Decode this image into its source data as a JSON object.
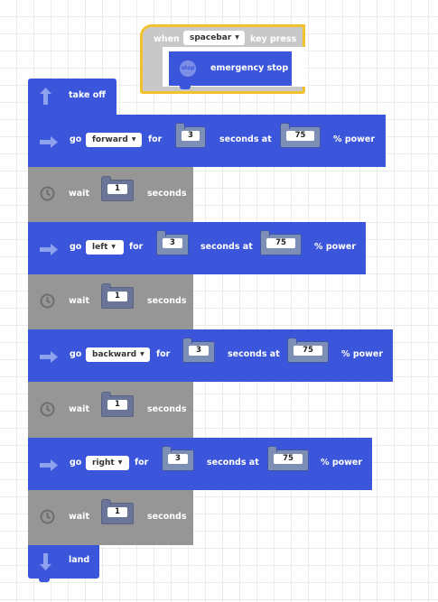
{
  "event": {
    "when_label": "when",
    "key_value": "spacebar",
    "key_press_label": "key press",
    "stop_icon_label": "stop",
    "action_label": "emergency stop"
  },
  "blocks": {
    "takeoff": {
      "label": "take off"
    },
    "go1": {
      "go": "go",
      "direction": "forward",
      "for": "for",
      "duration": "3",
      "seconds_at": "seconds at",
      "power": "75",
      "power_label": "% power"
    },
    "wait1": {
      "wait": "wait",
      "duration": "1",
      "seconds": "seconds"
    },
    "go2": {
      "go": "go",
      "direction": "left",
      "for": "for",
      "duration": "3",
      "seconds_at": "seconds at",
      "power": "75",
      "power_label": "% power"
    },
    "wait2": {
      "wait": "wait",
      "duration": "1",
      "seconds": "seconds"
    },
    "go3": {
      "go": "go",
      "direction": "backward",
      "for": "for",
      "duration": "3",
      "seconds_at": "seconds at",
      "power": "75",
      "power_label": "% power"
    },
    "wait3": {
      "wait": "wait",
      "duration": "1",
      "seconds": "seconds"
    },
    "go4": {
      "go": "go",
      "direction": "right",
      "for": "for",
      "duration": "3",
      "seconds_at": "seconds at",
      "power": "75",
      "power_label": "% power"
    },
    "wait4": {
      "wait": "wait",
      "duration": "1",
      "seconds": "seconds"
    },
    "land": {
      "label": "land"
    }
  },
  "icons": {
    "takeoff": "up-arrow-icon",
    "go": "right-arrow-icon",
    "wait": "clock-icon",
    "land": "down-arrow-icon",
    "stop": "stop-icon"
  },
  "colors": {
    "motion_block": "#3b56db",
    "wait_block": "#969696",
    "event_block": "#c8c8c8",
    "event_outline": "#f2c12e",
    "canvas": "#ffffff",
    "grid": "#ececec"
  }
}
